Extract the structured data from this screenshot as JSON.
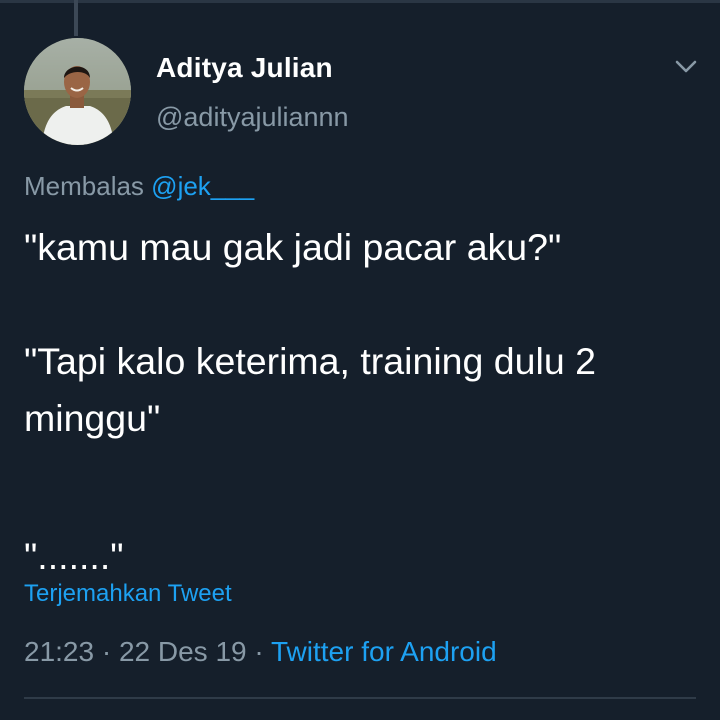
{
  "tweet": {
    "author": {
      "display_name": "Aditya Julian",
      "handle": "@adityajuliannn"
    },
    "reply": {
      "prefix": "Membalas",
      "mention": "@jek___"
    },
    "text_lines": [
      "\"kamu mau gak jadi pacar aku?\"",
      "\"Tapi kalo keterima, training dulu 2 minggu\"",
      "\".......\""
    ],
    "translate_label": "Terjemahkan Tweet",
    "time": "21:23",
    "date": "22 Des 19",
    "separator": "·",
    "source": "Twitter for Android"
  },
  "icons": {
    "chevron": "chevron-down-icon",
    "avatar": "profile-photo"
  },
  "colors": {
    "background": "#151f2b",
    "text_primary": "#ffffff",
    "text_secondary": "#8899a6",
    "link": "#1da1f2"
  }
}
